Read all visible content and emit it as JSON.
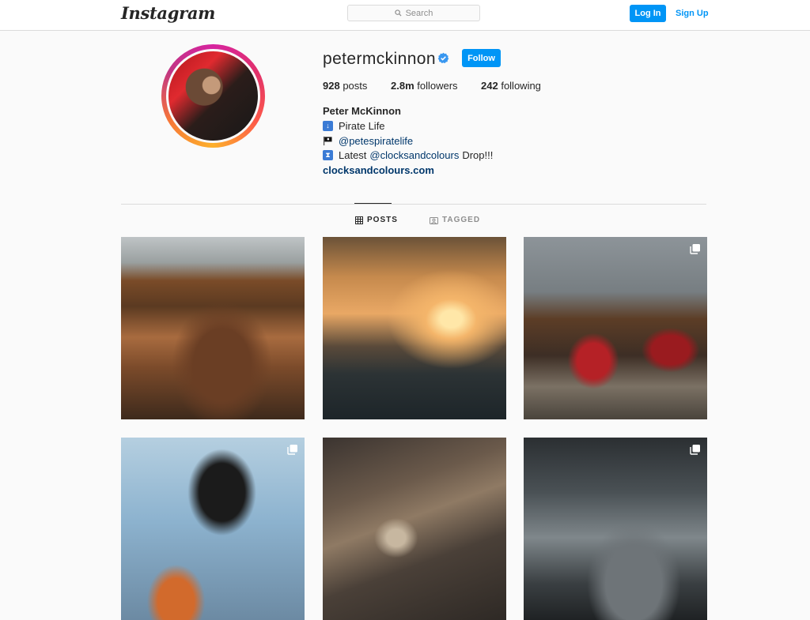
{
  "header": {
    "logo_text": "Instagram",
    "search_placeholder": "Search",
    "login_label": "Log In",
    "signup_label": "Sign Up"
  },
  "profile": {
    "username": "petermckinnon",
    "verified": true,
    "follow_label": "Follow",
    "posts_count": "928",
    "posts_label": "posts",
    "followers_count": "2.8m",
    "followers_label": "followers",
    "following_count": "242",
    "following_label": "following",
    "full_name": "Peter McKinnon",
    "bio": {
      "line1_text": "Pirate Life",
      "line2_mention": "@petespiratelife",
      "line3_prefix": "Latest",
      "line3_mention": "@clocksandcolours",
      "line3_suffix": "Drop!!!"
    },
    "website": "clocksandcolours.com"
  },
  "tabs": [
    {
      "label": "POSTS",
      "active": true
    },
    {
      "label": "TAGGED",
      "active": false
    }
  ],
  "posts": [
    {
      "subject": "motocross rider in dirt",
      "multi": false
    },
    {
      "subject": "truck at sunset",
      "multi": false
    },
    {
      "subject": "red truck with man",
      "multi": true
    },
    {
      "subject": "rider on motorcycle",
      "multi": true
    },
    {
      "subject": "aerial river delta",
      "multi": false
    },
    {
      "subject": "storm clouds",
      "multi": true
    }
  ],
  "colors": {
    "accent": "#0095f6",
    "link": "#00376b",
    "text": "#262626",
    "muted": "#8e8e8e",
    "border": "#dbdbdb",
    "background": "#fafafa"
  }
}
